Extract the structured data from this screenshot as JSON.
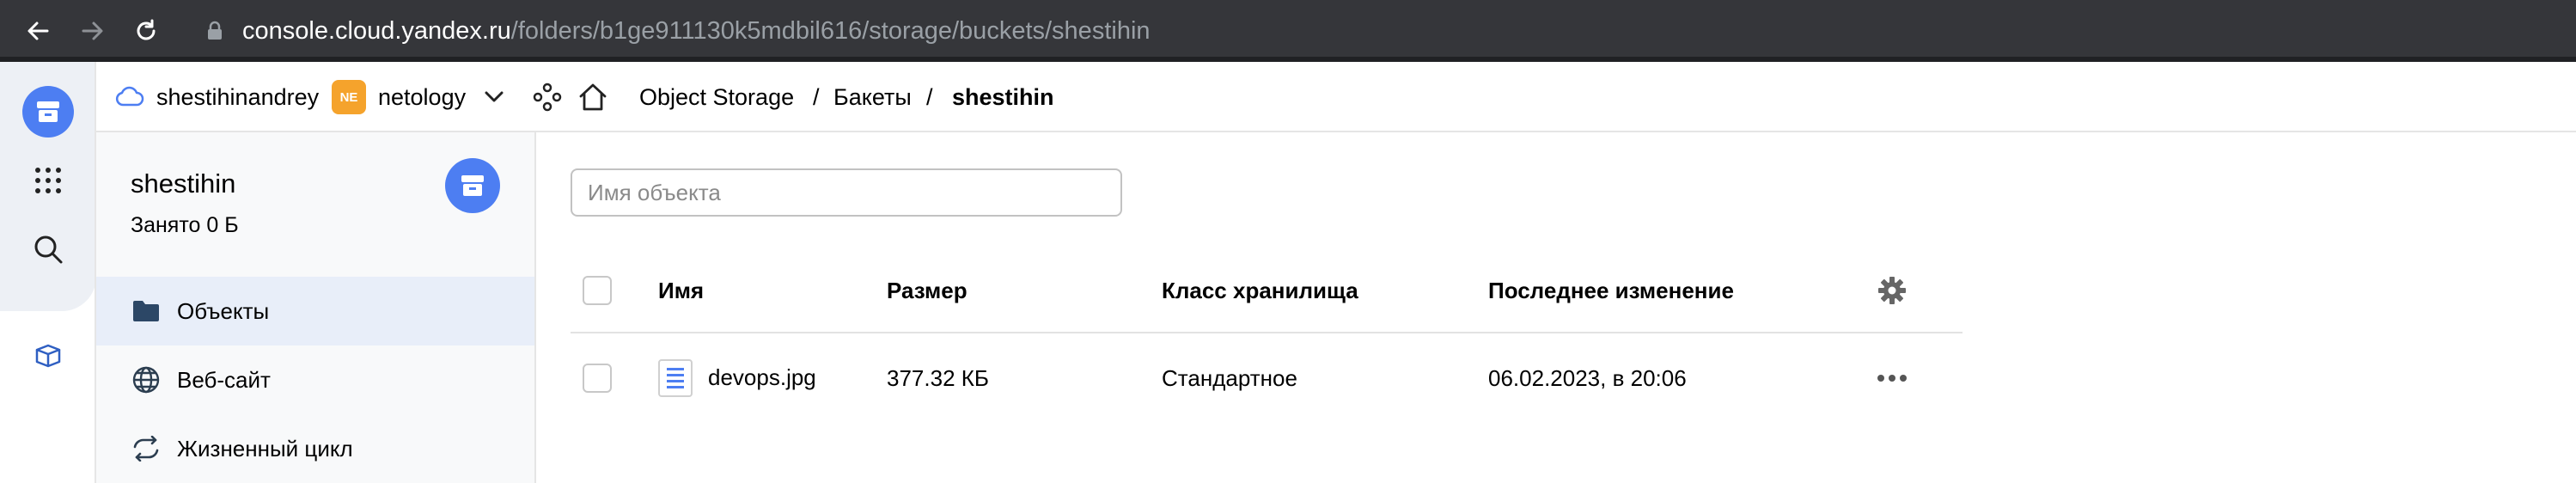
{
  "browser": {
    "url_host": "console.cloud.yandex.ru",
    "url_path": "/folders/b1ge911130k5mdbil616/storage/buckets/shestihin",
    "back_icon": "arrow-left-icon",
    "forward_icon": "arrow-right-icon",
    "reload_icon": "reload-icon",
    "lock_icon": "lock-icon"
  },
  "rail": {
    "items": [
      {
        "icon": "storage-logo-icon"
      },
      {
        "icon": "apps-grid-icon"
      },
      {
        "icon": "search-icon"
      },
      {
        "icon": "marketplace-box-icon"
      }
    ]
  },
  "header": {
    "cloud_name": "shestihinandrey",
    "folder_badge": "NE",
    "folder_name": "netology",
    "breadcrumbs": [
      "Object Storage",
      "Бакеты",
      "shestihin"
    ],
    "separator": "/"
  },
  "sidebar": {
    "bucket_name": "shestihin",
    "bucket_usage": "Занято 0 Б",
    "menu": [
      {
        "label": "Объекты",
        "icon": "folder-icon",
        "active": true
      },
      {
        "label": "Веб-сайт",
        "icon": "globe-icon",
        "active": false
      },
      {
        "label": "Жизненный цикл",
        "icon": "lifecycle-icon",
        "active": false
      }
    ]
  },
  "main": {
    "search_placeholder": "Имя объекта",
    "search_value": "",
    "columns": [
      "Имя",
      "Размер",
      "Класс хранилища",
      "Последнее изменение"
    ],
    "rows": [
      {
        "name": "devops.jpg",
        "size": "377.32 КБ",
        "storage_class": "Стандартное",
        "modified": "06.02.2023, в 20:06"
      }
    ]
  },
  "colors": {
    "accent": "#4d7ef2",
    "badge": "#f5a32c",
    "chrome": "#35363a",
    "active_menu": "#e8eef9"
  }
}
